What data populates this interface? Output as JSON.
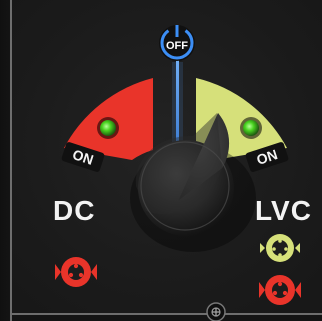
{
  "power": {
    "label": "OFF"
  },
  "dc": {
    "label": "DC",
    "on_label": "ON",
    "color": "#e9342a"
  },
  "lvc": {
    "label": "LVC",
    "on_label": "ON",
    "color": "#d6e07a"
  },
  "indicator_color": "#48d21f",
  "icons": {
    "power": "power-icon",
    "dc_connector": "red-connector-icon",
    "lvc_connector_yellow": "yellow-connector-icon",
    "lvc_connector_red": "red-connector-icon",
    "screw": "screw-icon"
  }
}
